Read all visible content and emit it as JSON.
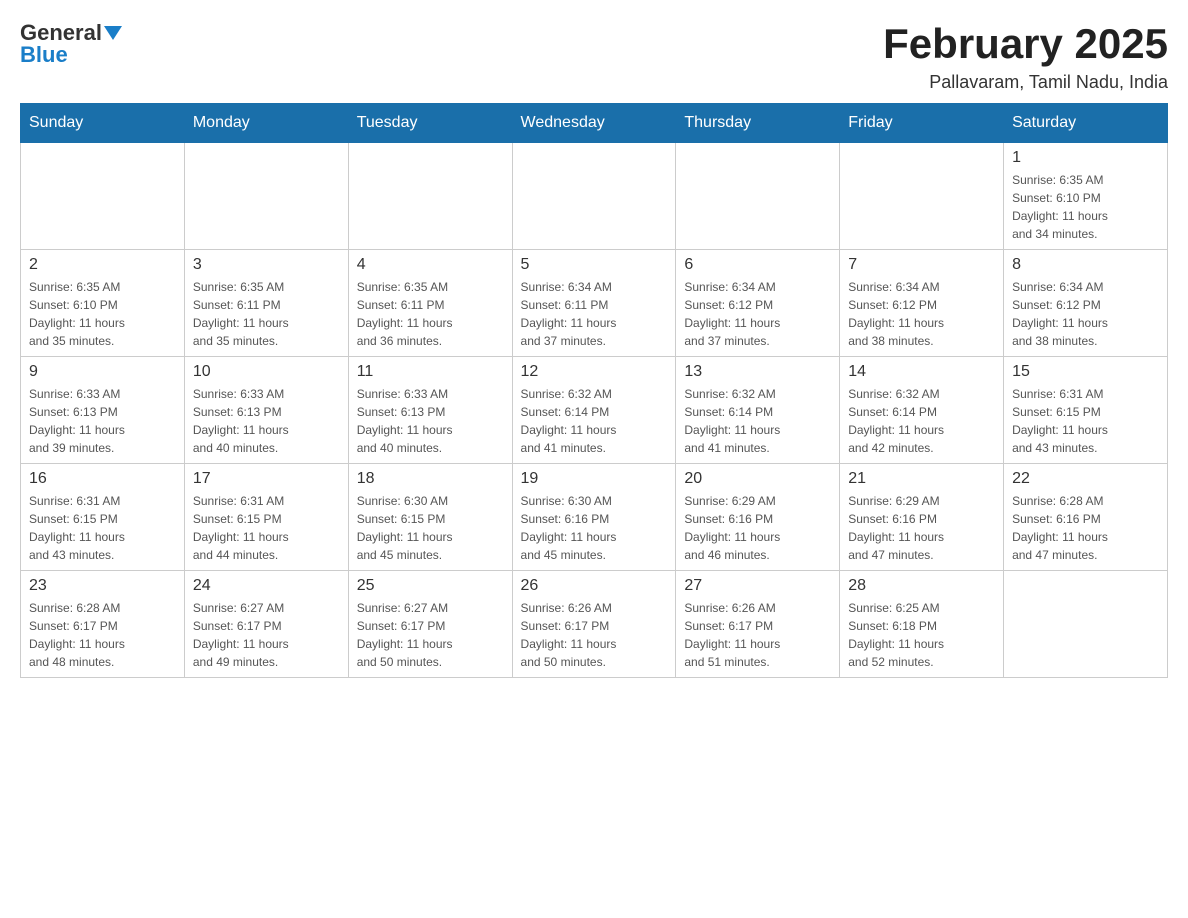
{
  "header": {
    "logo_general": "General",
    "logo_blue": "Blue",
    "title": "February 2025",
    "location": "Pallavaram, Tamil Nadu, India"
  },
  "days_of_week": [
    "Sunday",
    "Monday",
    "Tuesday",
    "Wednesday",
    "Thursday",
    "Friday",
    "Saturday"
  ],
  "weeks": [
    [
      {
        "day": "",
        "info": ""
      },
      {
        "day": "",
        "info": ""
      },
      {
        "day": "",
        "info": ""
      },
      {
        "day": "",
        "info": ""
      },
      {
        "day": "",
        "info": ""
      },
      {
        "day": "",
        "info": ""
      },
      {
        "day": "1",
        "info": "Sunrise: 6:35 AM\nSunset: 6:10 PM\nDaylight: 11 hours\nand 34 minutes."
      }
    ],
    [
      {
        "day": "2",
        "info": "Sunrise: 6:35 AM\nSunset: 6:10 PM\nDaylight: 11 hours\nand 35 minutes."
      },
      {
        "day": "3",
        "info": "Sunrise: 6:35 AM\nSunset: 6:11 PM\nDaylight: 11 hours\nand 35 minutes."
      },
      {
        "day": "4",
        "info": "Sunrise: 6:35 AM\nSunset: 6:11 PM\nDaylight: 11 hours\nand 36 minutes."
      },
      {
        "day": "5",
        "info": "Sunrise: 6:34 AM\nSunset: 6:11 PM\nDaylight: 11 hours\nand 37 minutes."
      },
      {
        "day": "6",
        "info": "Sunrise: 6:34 AM\nSunset: 6:12 PM\nDaylight: 11 hours\nand 37 minutes."
      },
      {
        "day": "7",
        "info": "Sunrise: 6:34 AM\nSunset: 6:12 PM\nDaylight: 11 hours\nand 38 minutes."
      },
      {
        "day": "8",
        "info": "Sunrise: 6:34 AM\nSunset: 6:12 PM\nDaylight: 11 hours\nand 38 minutes."
      }
    ],
    [
      {
        "day": "9",
        "info": "Sunrise: 6:33 AM\nSunset: 6:13 PM\nDaylight: 11 hours\nand 39 minutes."
      },
      {
        "day": "10",
        "info": "Sunrise: 6:33 AM\nSunset: 6:13 PM\nDaylight: 11 hours\nand 40 minutes."
      },
      {
        "day": "11",
        "info": "Sunrise: 6:33 AM\nSunset: 6:13 PM\nDaylight: 11 hours\nand 40 minutes."
      },
      {
        "day": "12",
        "info": "Sunrise: 6:32 AM\nSunset: 6:14 PM\nDaylight: 11 hours\nand 41 minutes."
      },
      {
        "day": "13",
        "info": "Sunrise: 6:32 AM\nSunset: 6:14 PM\nDaylight: 11 hours\nand 41 minutes."
      },
      {
        "day": "14",
        "info": "Sunrise: 6:32 AM\nSunset: 6:14 PM\nDaylight: 11 hours\nand 42 minutes."
      },
      {
        "day": "15",
        "info": "Sunrise: 6:31 AM\nSunset: 6:15 PM\nDaylight: 11 hours\nand 43 minutes."
      }
    ],
    [
      {
        "day": "16",
        "info": "Sunrise: 6:31 AM\nSunset: 6:15 PM\nDaylight: 11 hours\nand 43 minutes."
      },
      {
        "day": "17",
        "info": "Sunrise: 6:31 AM\nSunset: 6:15 PM\nDaylight: 11 hours\nand 44 minutes."
      },
      {
        "day": "18",
        "info": "Sunrise: 6:30 AM\nSunset: 6:15 PM\nDaylight: 11 hours\nand 45 minutes."
      },
      {
        "day": "19",
        "info": "Sunrise: 6:30 AM\nSunset: 6:16 PM\nDaylight: 11 hours\nand 45 minutes."
      },
      {
        "day": "20",
        "info": "Sunrise: 6:29 AM\nSunset: 6:16 PM\nDaylight: 11 hours\nand 46 minutes."
      },
      {
        "day": "21",
        "info": "Sunrise: 6:29 AM\nSunset: 6:16 PM\nDaylight: 11 hours\nand 47 minutes."
      },
      {
        "day": "22",
        "info": "Sunrise: 6:28 AM\nSunset: 6:16 PM\nDaylight: 11 hours\nand 47 minutes."
      }
    ],
    [
      {
        "day": "23",
        "info": "Sunrise: 6:28 AM\nSunset: 6:17 PM\nDaylight: 11 hours\nand 48 minutes."
      },
      {
        "day": "24",
        "info": "Sunrise: 6:27 AM\nSunset: 6:17 PM\nDaylight: 11 hours\nand 49 minutes."
      },
      {
        "day": "25",
        "info": "Sunrise: 6:27 AM\nSunset: 6:17 PM\nDaylight: 11 hours\nand 50 minutes."
      },
      {
        "day": "26",
        "info": "Sunrise: 6:26 AM\nSunset: 6:17 PM\nDaylight: 11 hours\nand 50 minutes."
      },
      {
        "day": "27",
        "info": "Sunrise: 6:26 AM\nSunset: 6:17 PM\nDaylight: 11 hours\nand 51 minutes."
      },
      {
        "day": "28",
        "info": "Sunrise: 6:25 AM\nSunset: 6:18 PM\nDaylight: 11 hours\nand 52 minutes."
      },
      {
        "day": "",
        "info": ""
      }
    ]
  ]
}
